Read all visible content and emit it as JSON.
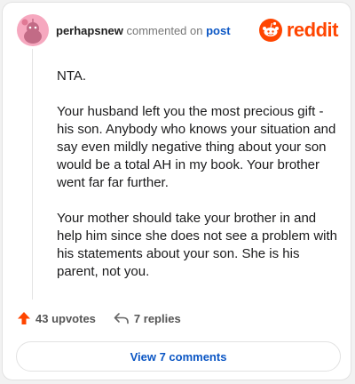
{
  "header": {
    "username": "perhapsnew",
    "action_text": "commented on",
    "post_link": "post",
    "brand_name": "reddit"
  },
  "comment": {
    "paragraphs": [
      "NTA.",
      "Your husband left you the most precious gift - his son. Anybody who knows your situation and say even mildly negative thing about your son would be a total AH in my book. Your brother went far far further.",
      "Your mother should take your brother in and help him since she does not see a problem with his statements about your son. She is his parent, not you."
    ]
  },
  "actions": {
    "upvotes": "43 upvotes",
    "replies": "7 replies"
  },
  "view_button": "View 7 comments",
  "colors": {
    "brand": "#ff4500",
    "link": "#0b56c4",
    "avatar_bg": "#f6a8bf"
  },
  "icons": [
    "avatar-icon",
    "reddit-logo-icon",
    "upvote-arrow-icon",
    "reply-arrow-icon"
  ]
}
